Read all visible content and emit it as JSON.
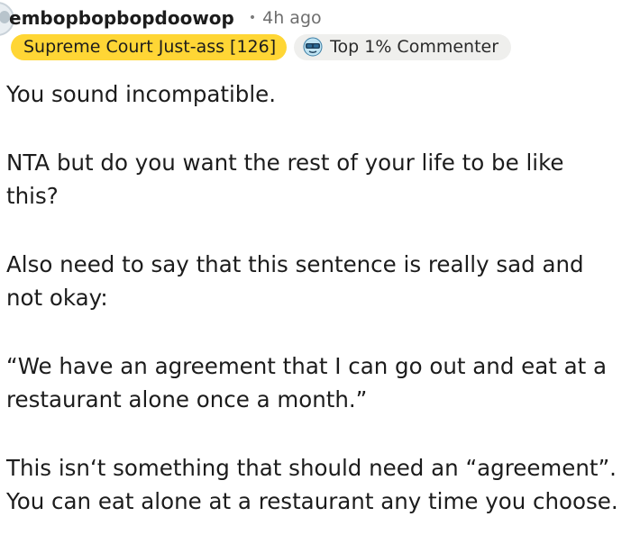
{
  "comment": {
    "username": "embopbopbopdoowop",
    "separator": "•",
    "timestamp": "4h ago",
    "user_flair": "Supreme Court Just-ass [126]",
    "achievement_flair": "Top 1% Commenter",
    "achievement_icon": "sunglasses-badge-icon",
    "paragraphs": [
      "You sound incompatible.",
      "NTA but do you want the rest of your life to be like\nthis?",
      "Also need to say that this sentence is really sad and\nnot okay:",
      "“We have an agreement that I can go out and eat at a\nrestaurant alone once a month.”",
      "This isn‘t something that should need an “agreement”.\nYou can eat alone at a restaurant any time you choose."
    ]
  },
  "colors": {
    "user_flair_bg": "#ffd635",
    "achievement_flair_bg": "#efefed",
    "text": "#1c1c1c",
    "meta": "#6e6e6e"
  }
}
